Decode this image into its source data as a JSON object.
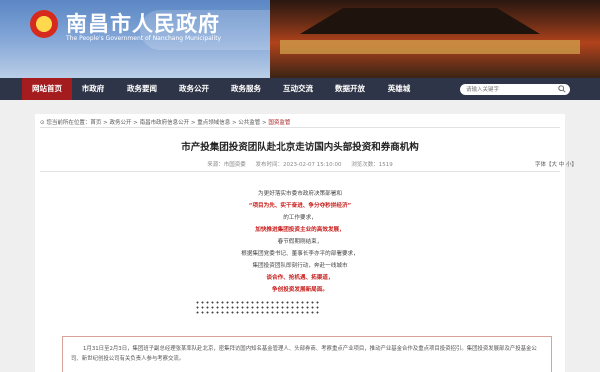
{
  "header": {
    "title": "南昌市人民政府",
    "subtitle": "The People's Government of Nanchang Municipality"
  },
  "nav": {
    "items": [
      {
        "label": "网站首页",
        "active": true
      },
      {
        "label": "市政府",
        "active": false
      },
      {
        "label": "政务要闻",
        "active": false
      },
      {
        "label": "政务公开",
        "active": false
      },
      {
        "label": "政务服务",
        "active": false
      },
      {
        "label": "互动交流",
        "active": false
      },
      {
        "label": "数据开放",
        "active": false
      },
      {
        "label": "英雄城",
        "active": false
      }
    ],
    "search_placeholder": "请输入关键字"
  },
  "breadcrumb": {
    "prefix": "您当前所在位置：",
    "path": "首页 > 政务公开 > 南昌市政府信息公开 > 重点领域信息 > 公共监管 > ",
    "current": "国资监管"
  },
  "article": {
    "title": "市产投集团投资团队赴北京走访国内头部投资和券商机构",
    "source": "来源：市国资委",
    "date": "发布时间：2023-02-07 15:10:00",
    "views": "浏览次数：1519",
    "font_size_label": "字体【大 中 小】",
    "lines": [
      {
        "text": "为更好落实市委市政府决策部署和",
        "red": false
      },
      {
        "text": "“项目为先、实干奋进、争分夺秒拼经济”",
        "red": true
      },
      {
        "text": "的工作要求，",
        "red": false
      },
      {
        "text": "加快推进集团投资主业的高效发展，",
        "red": true
      },
      {
        "text": "春节假期刚结束，",
        "red": false
      },
      {
        "text": "根据集团党委书记、董事长李亦平的部署要求，",
        "red": false
      },
      {
        "text": "集团投资团队即刻行动，奔赴一线城市",
        "red": false
      },
      {
        "text": "谈合作、抢机遇、拓渠道，",
        "red": true
      },
      {
        "text": "争创投资发展新局面。",
        "red": true
      }
    ],
    "intro": "1月31日至2月3日，集团班子副总经理张某率队赴北京，密集拜访国内知名基金管理人、头部券商、考察重点产业项目，推动产业基金合作及重点项目投资招引。集团投资发展部及产投基金公司、新世纪创投公司有关负责人参与考察交流。"
  }
}
